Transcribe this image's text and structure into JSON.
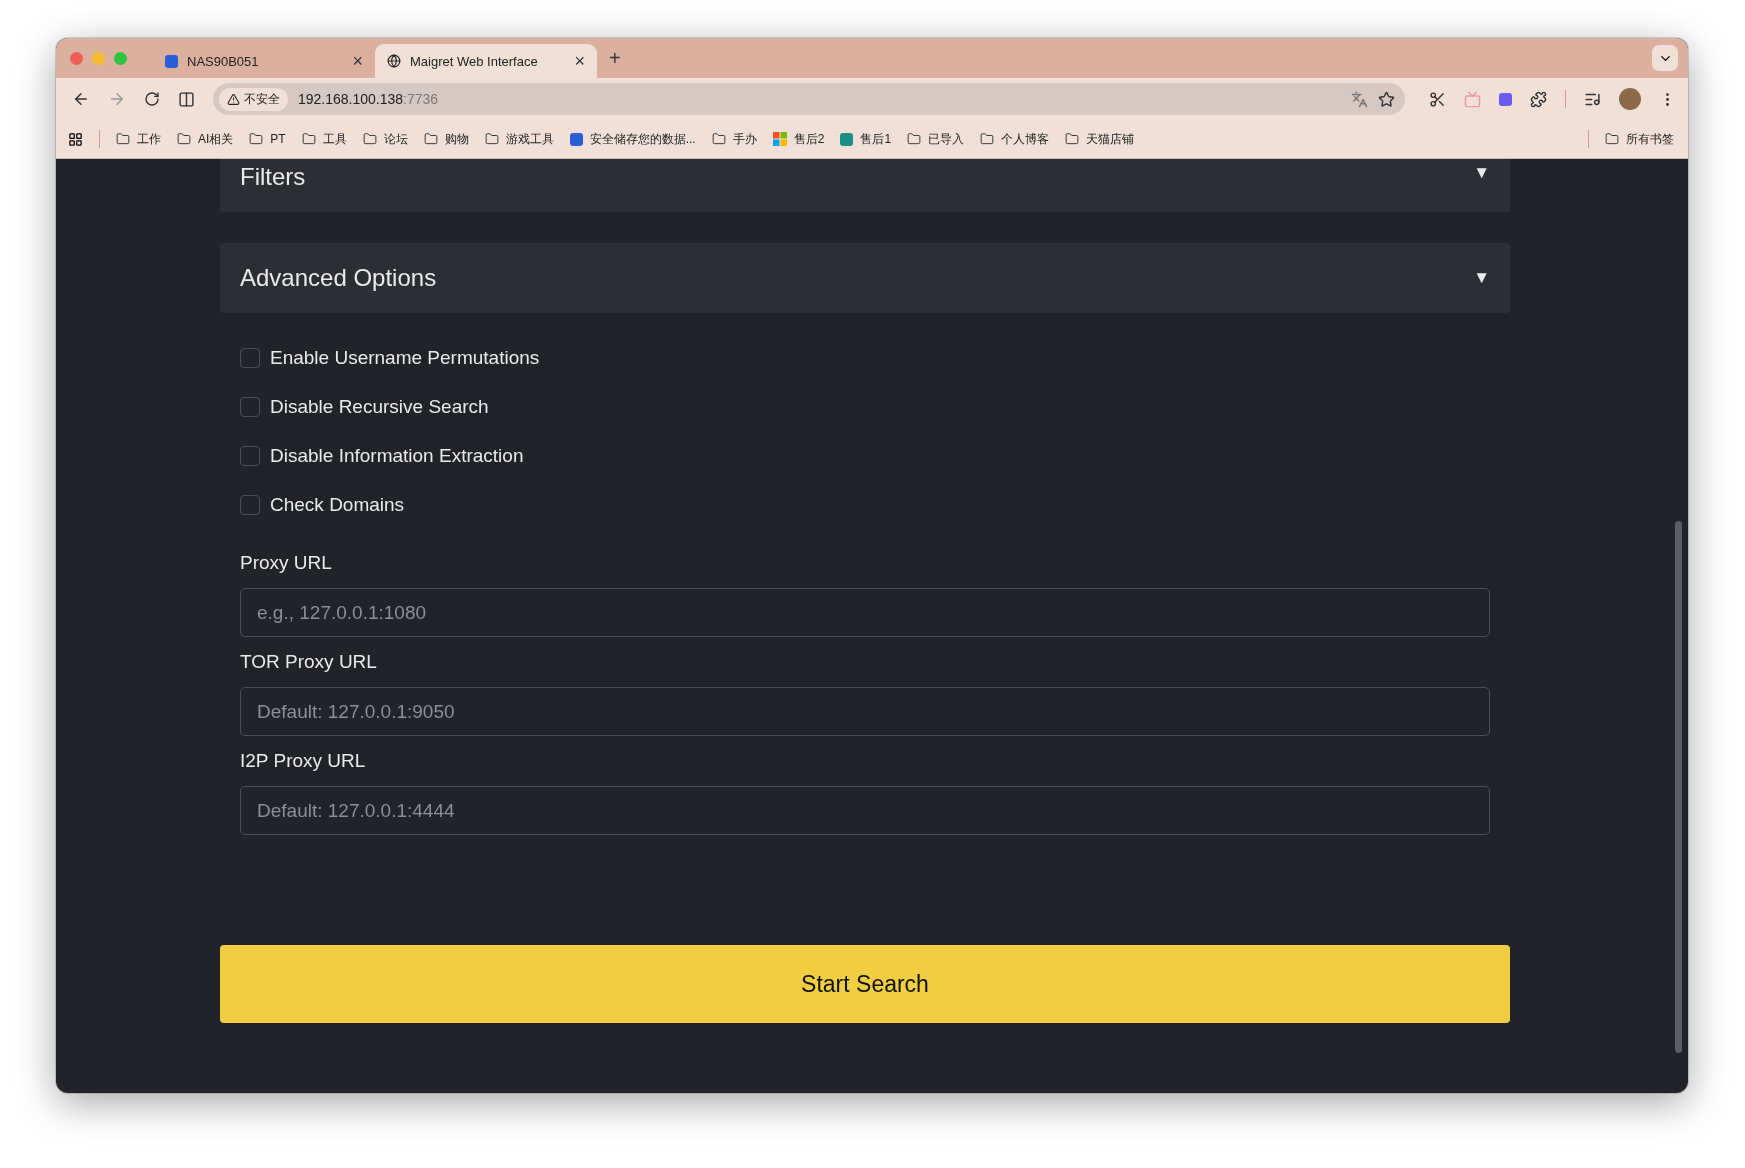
{
  "browser": {
    "tabs": [
      {
        "title": "NAS90B051",
        "selected": false,
        "kind": "app",
        "close": "×"
      },
      {
        "title": "Maigret Web Interface",
        "selected": true,
        "kind": "globe",
        "close": "×"
      }
    ],
    "new_tab": "+",
    "address": {
      "security": "不安全",
      "host": "192.168.100.138",
      "port": ":7736"
    },
    "bookmarks": [
      {
        "label": "工作",
        "kind": "folder"
      },
      {
        "label": "AI相关",
        "kind": "folder"
      },
      {
        "label": "PT",
        "kind": "folder"
      },
      {
        "label": "工具",
        "kind": "folder"
      },
      {
        "label": "论坛",
        "kind": "folder"
      },
      {
        "label": "购物",
        "kind": "folder"
      },
      {
        "label": "游戏工具",
        "kind": "folder"
      },
      {
        "label": "安全储存您的数据...",
        "kind": "app"
      },
      {
        "label": "手办",
        "kind": "folder"
      },
      {
        "label": "售后2",
        "kind": "grid"
      },
      {
        "label": "售后1",
        "kind": "share"
      },
      {
        "label": "已导入",
        "kind": "folder"
      },
      {
        "label": "个人博客",
        "kind": "folder"
      },
      {
        "label": "天猫店铺",
        "kind": "folder"
      }
    ],
    "all_bookmarks": "所有书签"
  },
  "page": {
    "sections": [
      {
        "title": "Filters",
        "toggle": "▼"
      },
      {
        "title": "Advanced Options",
        "toggle": "▼"
      }
    ],
    "options": [
      {
        "label": "Enable Username Permutations",
        "checked": false
      },
      {
        "label": "Disable Recursive Search",
        "checked": false
      },
      {
        "label": "Disable Information Extraction",
        "checked": false
      },
      {
        "label": "Check Domains",
        "checked": false
      }
    ],
    "fields": [
      {
        "label": "Proxy URL",
        "placeholder": "e.g., 127.0.0.1:1080"
      },
      {
        "label": "TOR Proxy URL",
        "placeholder": "Default: 127.0.0.1:9050"
      },
      {
        "label": "I2P Proxy URL",
        "placeholder": "Default: 127.0.0.1:4444"
      }
    ],
    "submit": "Start Search"
  }
}
